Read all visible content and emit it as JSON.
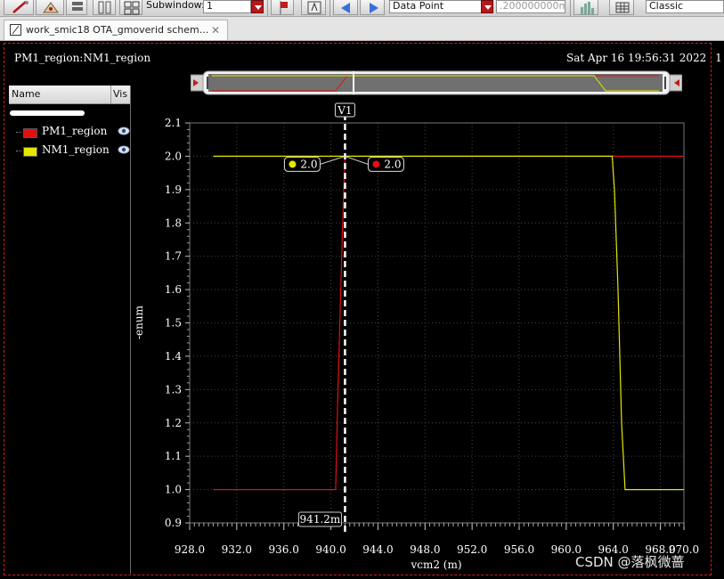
{
  "toolbar": {
    "subwindow_label": "Subwindow:",
    "subwindow_value": "1",
    "marker_type": "Data Point",
    "step_value": ".200000000m",
    "style_value": "Classic"
  },
  "tab": {
    "title": "work_smic18 OTA_gmoverid schem...",
    "close": "✕"
  },
  "header": {
    "expression": "PM1_region:NM1_region",
    "timestamp": "Sat Apr 16 19:56:31 2022",
    "index": "1"
  },
  "legend": {
    "name_header": "Name",
    "vis_header": "Vis",
    "items": [
      {
        "label": "PM1_region",
        "color": "#e01010"
      },
      {
        "label": "NM1_region",
        "color": "#e6e600"
      }
    ]
  },
  "marker": {
    "name": "V1",
    "x_label": "941.2m",
    "x_value": 941.2,
    "callouts": [
      {
        "series": "NM1_region",
        "value_label": "2.0",
        "color": "#e6e600"
      },
      {
        "series": "PM1_region",
        "value_label": "2.0",
        "color": "#e01010"
      }
    ]
  },
  "watermark": "CSDN @落枫微蔷",
  "chart_data": {
    "type": "line",
    "xlabel": "vcm2 (m)",
    "ylabel": "-enum",
    "xlim": [
      928.0,
      970.0
    ],
    "ylim": [
      0.9,
      2.1
    ],
    "x_ticks": [
      "928.0",
      "932.0",
      "936.0",
      "940.0",
      "944.0",
      "948.0",
      "952.0",
      "956.0",
      "960.0",
      "964.0",
      "968.0",
      "970.0"
    ],
    "y_ticks": [
      "0.9",
      "1.0",
      "1.1",
      "1.2",
      "1.3",
      "1.4",
      "1.5",
      "1.6",
      "1.7",
      "1.8",
      "1.9",
      "2.0",
      "2.1"
    ],
    "grid": true,
    "series": [
      {
        "name": "PM1_region",
        "color": "#e01010",
        "points": [
          [
            930.0,
            1.0
          ],
          [
            940.4,
            1.0
          ],
          [
            940.6,
            1.3
          ],
          [
            941.0,
            1.8
          ],
          [
            941.2,
            2.0
          ],
          [
            970.0,
            2.0
          ]
        ]
      },
      {
        "name": "NM1_region",
        "color": "#e6e600",
        "points": [
          [
            930.0,
            2.0
          ],
          [
            963.9,
            2.0
          ],
          [
            964.1,
            1.9
          ],
          [
            964.4,
            1.6
          ],
          [
            964.7,
            1.2
          ],
          [
            965.0,
            1.0
          ],
          [
            970.0,
            1.0
          ]
        ]
      }
    ]
  }
}
